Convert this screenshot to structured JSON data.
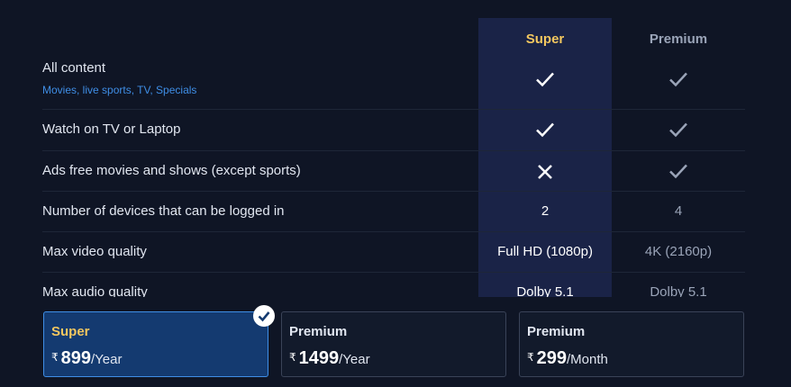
{
  "columns": {
    "super": "Super",
    "premium": "Premium"
  },
  "rows": [
    {
      "label": "All content",
      "sublabel": "Movies, live sports, TV, Specials",
      "super": "check",
      "premium": "check"
    },
    {
      "label": "Watch on TV or Laptop",
      "super": "check",
      "premium": "check"
    },
    {
      "label": "Ads free movies and shows (except sports)",
      "super": "cross",
      "premium": "check"
    },
    {
      "label": "Number of devices that can be logged in",
      "super": "2",
      "premium": "4"
    },
    {
      "label": "Max video quality",
      "super": "Full HD (1080p)",
      "premium": "4K (2160p)"
    },
    {
      "label": "Max audio quality",
      "super": "Dolby 5.1",
      "premium": "Dolby 5.1"
    }
  ],
  "plans": [
    {
      "name": "Super",
      "currency": "₹",
      "amount": "899",
      "period": "/Year",
      "selected": true
    },
    {
      "name": "Premium",
      "currency": "₹",
      "amount": "1499",
      "period": "/Year",
      "selected": false
    },
    {
      "name": "Premium",
      "currency": "₹",
      "amount": "299",
      "period": "/Month",
      "selected": false
    }
  ],
  "icons": {
    "check": "check-icon",
    "cross": "cross-icon",
    "selected": "selected-check-icon"
  },
  "colors": {
    "background": "#0f1525",
    "super_column": "#1a2347",
    "super_accent": "#f3c75f",
    "link_blue": "#3f8ee6",
    "selected_card": "#143a70"
  }
}
